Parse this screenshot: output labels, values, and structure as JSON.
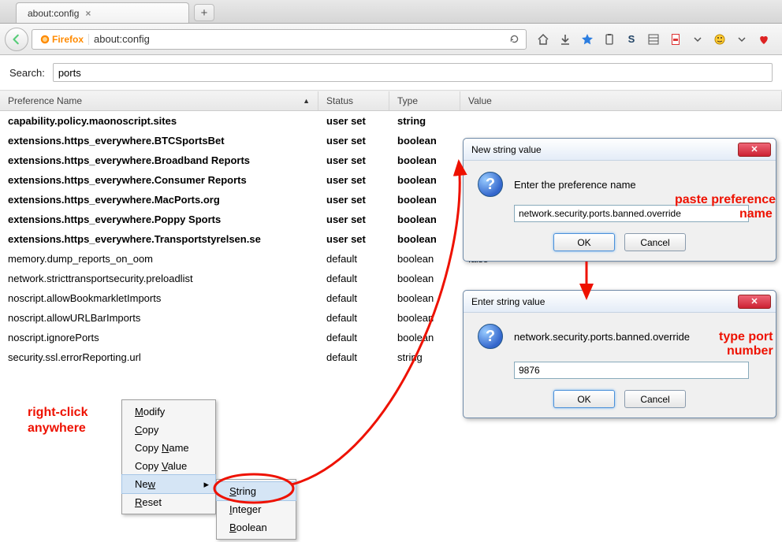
{
  "tab": {
    "title": "about:config"
  },
  "urlbar": {
    "brand": "Firefox",
    "url": "about:config"
  },
  "search": {
    "label": "Search:",
    "value": "ports"
  },
  "columns": {
    "name": "Preference Name",
    "status": "Status",
    "type": "Type",
    "value": "Value"
  },
  "rows": [
    {
      "name": "capability.policy.maonoscript.sites",
      "status": "user set",
      "type": "string",
      "value": "",
      "bold": true
    },
    {
      "name": "extensions.https_everywhere.BTCSportsBet",
      "status": "user set",
      "type": "boolean",
      "value": "",
      "bold": true
    },
    {
      "name": "extensions.https_everywhere.Broadband Reports",
      "status": "user set",
      "type": "boolean",
      "value": "",
      "bold": true
    },
    {
      "name": "extensions.https_everywhere.Consumer Reports",
      "status": "user set",
      "type": "boolean",
      "value": "",
      "bold": true
    },
    {
      "name": "extensions.https_everywhere.MacPorts.org",
      "status": "user set",
      "type": "boolean",
      "value": "",
      "bold": true
    },
    {
      "name": "extensions.https_everywhere.Poppy Sports",
      "status": "user set",
      "type": "boolean",
      "value": "",
      "bold": true
    },
    {
      "name": "extensions.https_everywhere.Transportstyrelsen.se",
      "status": "user set",
      "type": "boolean",
      "value": "",
      "bold": true
    },
    {
      "name": "memory.dump_reports_on_oom",
      "status": "default",
      "type": "boolean",
      "value": "false",
      "bold": false
    },
    {
      "name": "network.stricttransportsecurity.preloadlist",
      "status": "default",
      "type": "boolean",
      "value": "",
      "bold": false
    },
    {
      "name": "noscript.allowBookmarkletImports",
      "status": "default",
      "type": "boolean",
      "value": "",
      "bold": false
    },
    {
      "name": "noscript.allowURLBarImports",
      "status": "default",
      "type": "boolean",
      "value": "",
      "bold": false
    },
    {
      "name": "noscript.ignorePorts",
      "status": "default",
      "type": "boolean",
      "value": "",
      "bold": false
    },
    {
      "name": "security.ssl.errorReporting.url",
      "status": "default",
      "type": "string",
      "value": "",
      "bold": false
    }
  ],
  "ctx1": {
    "modify": "Modify",
    "copy": "Copy",
    "copyName": "Copy Name",
    "copyValue": "Copy Value",
    "new": "New",
    "reset": "Reset"
  },
  "ctx2": {
    "string": "String",
    "integer": "Integer",
    "boolean": "Boolean"
  },
  "dlg1": {
    "title": "New string value",
    "label": "Enter the preference name",
    "value": "network.security.ports.banned.override",
    "ok": "OK",
    "cancel": "Cancel"
  },
  "dlg2": {
    "title": "Enter string value",
    "label": "network.security.ports.banned.override",
    "value": "9876",
    "ok": "OK",
    "cancel": "Cancel"
  },
  "anno": {
    "rightclick1": "right-click",
    "rightclick2": "anywhere",
    "paste1": "paste preference",
    "paste2": "name",
    "type1": "type port",
    "type2": "number"
  }
}
